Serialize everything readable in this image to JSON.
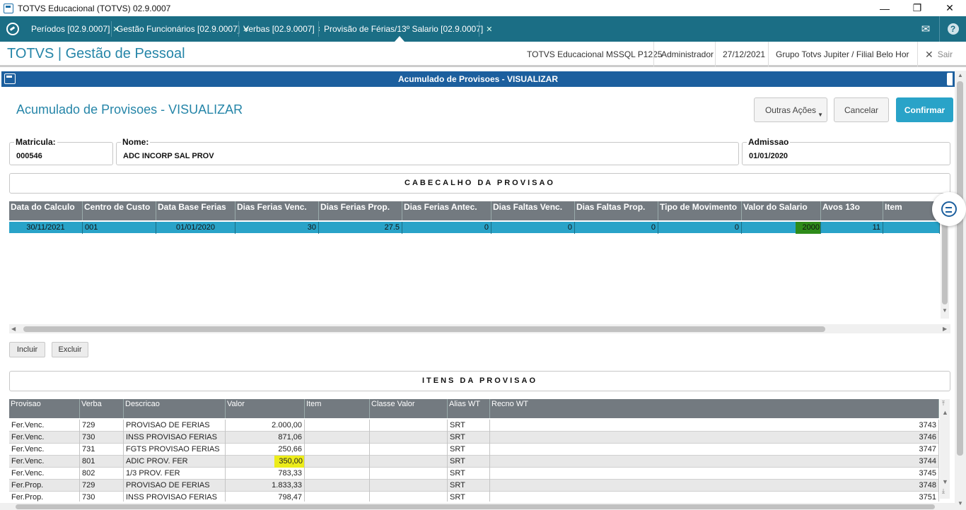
{
  "window": {
    "title": "TOTVS Educacional (TOTVS) 02.9.0007"
  },
  "tabs": [
    {
      "label": "Períodos [02.9.0007]"
    },
    {
      "label": "Gestão Funcionários [02.9.0007]"
    },
    {
      "label": "Verbas [02.9.0007]"
    },
    {
      "label": "Provisão de Férias/13º Salario [02.9.0007]"
    }
  ],
  "header": {
    "brand": "TOTVS | Gestão de Pessoal",
    "environment": "TOTVS Educacional MSSQL P1225",
    "user": "Administrador",
    "date": "27/12/2021",
    "company": "Grupo Totvs Jupiter / Filial Belo Hor",
    "exit_label": "Sair"
  },
  "dialog": {
    "bar_title": "Acumulado de Provisoes - VISUALIZAR",
    "title": "Acumulado de Provisoes - VISUALIZAR",
    "buttons": {
      "other_actions": "Outras Ações",
      "cancel": "Cancelar",
      "confirm": "Confirmar"
    }
  },
  "fields": {
    "matricula": {
      "label": "Matricula:",
      "value": "000546"
    },
    "nome": {
      "label": "Nome:",
      "value": "ADC INCORP SAL PROV"
    },
    "admissao": {
      "label": "Admissao",
      "value": "01/01/2020"
    }
  },
  "header_section": {
    "title": "CABECALHO DA PROVISAO",
    "columns": [
      "Data do Calculo",
      "Centro de Custo",
      "Data Base Ferias",
      "Dias Ferias Venc.",
      "Dias Ferias Prop.",
      "Dias Ferias Antec.",
      "Dias Faltas Venc.",
      "Dias Faltas Prop.",
      "Tipo de Movimento",
      "Valor do Salario",
      "Avos 13o",
      "Item"
    ],
    "row": [
      "30/11/2021",
      "001",
      "01/01/2020",
      "30",
      "27.5",
      "0",
      "0",
      "0",
      "0",
      "2000",
      "11",
      ""
    ],
    "include_label": "Incluir",
    "exclude_label": "Excluir"
  },
  "items_section": {
    "title": "ITENS DA PROVISAO",
    "columns": [
      "Provisao",
      "Verba",
      "Descricao",
      "Valor",
      "Item",
      "Classe Valor",
      "Alias WT",
      "Recno WT"
    ],
    "rows": [
      [
        "Fer.Venc.",
        "729",
        "PROVISAO DE FERIAS",
        "2.000,00",
        "",
        "",
        "SRT",
        "3743"
      ],
      [
        "Fer.Venc.",
        "730",
        "INSS PROVISAO FERIAS",
        "871,06",
        "",
        "",
        "SRT",
        "3746"
      ],
      [
        "Fer.Venc.",
        "731",
        "FGTS PROVISAO FERIAS",
        "250,66",
        "",
        "",
        "SRT",
        "3747"
      ],
      [
        "Fer.Venc.",
        "801",
        "ADIC PROV. FER",
        "350,00",
        "",
        "",
        "SRT",
        "3744"
      ],
      [
        "Fer.Venc.",
        "802",
        "1/3 PROV. FER",
        "783,33",
        "",
        "",
        "SRT",
        "3745"
      ],
      [
        "Fer.Prop.",
        "729",
        "PROVISAO DE FERIAS",
        "1.833,33",
        "",
        "",
        "SRT",
        "3748"
      ],
      [
        "Fer.Prop.",
        "730",
        "INSS PROVISAO FERIAS",
        "798,47",
        "",
        "",
        "SRT",
        "3751"
      ]
    ]
  },
  "colors": {
    "accent": "#1b6e85",
    "brand": "#2585a8",
    "selected_row": "#29a3c8",
    "dialog_bar": "#1c5f9e",
    "highlight_green": "#2e8b1a",
    "highlight_yellow": "#ecec1a"
  }
}
